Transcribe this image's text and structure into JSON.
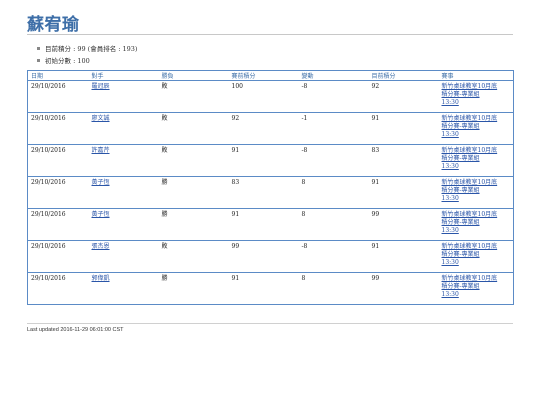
{
  "header": {
    "title": "蘇宥瑜"
  },
  "info": [
    "目前積分 : 99 (會員排名 : 193)",
    "初始分數 : 100"
  ],
  "table": {
    "columns": [
      "日期",
      "對手",
      "勝負",
      "賽前積分",
      "變動",
      "目前積分",
      "賽事"
    ],
    "rows": [
      {
        "date": "29/10/2016",
        "opponent": "羅冠辰",
        "result": "敗",
        "before": "100",
        "change": "-8",
        "after": "92",
        "event": "新竹桌球教室10月底\n積分賽-專業組\n13:30"
      },
      {
        "date": "29/10/2016",
        "opponent": "廖文誠",
        "result": "敗",
        "before": "92",
        "change": "-1",
        "after": "91",
        "event": "新竹桌球教室10月底\n積分賽-專業組\n13:30"
      },
      {
        "date": "29/10/2016",
        "opponent": "許嘉芹",
        "result": "敗",
        "before": "91",
        "change": "-8",
        "after": "83",
        "event": "新竹桌球教室10月底\n積分賽-專業組\n13:30"
      },
      {
        "date": "29/10/2016",
        "opponent": "黃子恆",
        "result": "勝",
        "before": "83",
        "change": "8",
        "after": "91",
        "event": "新竹桌球教室10月底\n積分賽-專業組\n13:30"
      },
      {
        "date": "29/10/2016",
        "opponent": "黃子恆",
        "result": "勝",
        "before": "91",
        "change": "8",
        "after": "99",
        "event": "新竹桌球教室10月底\n積分賽-專業組\n13:30"
      },
      {
        "date": "29/10/2016",
        "opponent": "張杰恩",
        "result": "敗",
        "before": "99",
        "change": "-8",
        "after": "91",
        "event": "新竹桌球教室10月底\n積分賽-專業組\n13:30"
      },
      {
        "date": "29/10/2016",
        "opponent": "郭偉凱",
        "result": "勝",
        "before": "91",
        "change": "8",
        "after": "99",
        "event": "新竹桌球教室10月底\n積分賽-專業組\n13:30"
      }
    ]
  },
  "footer": {
    "text": "Last updated 2016-11-29 06:01:00 CST"
  }
}
